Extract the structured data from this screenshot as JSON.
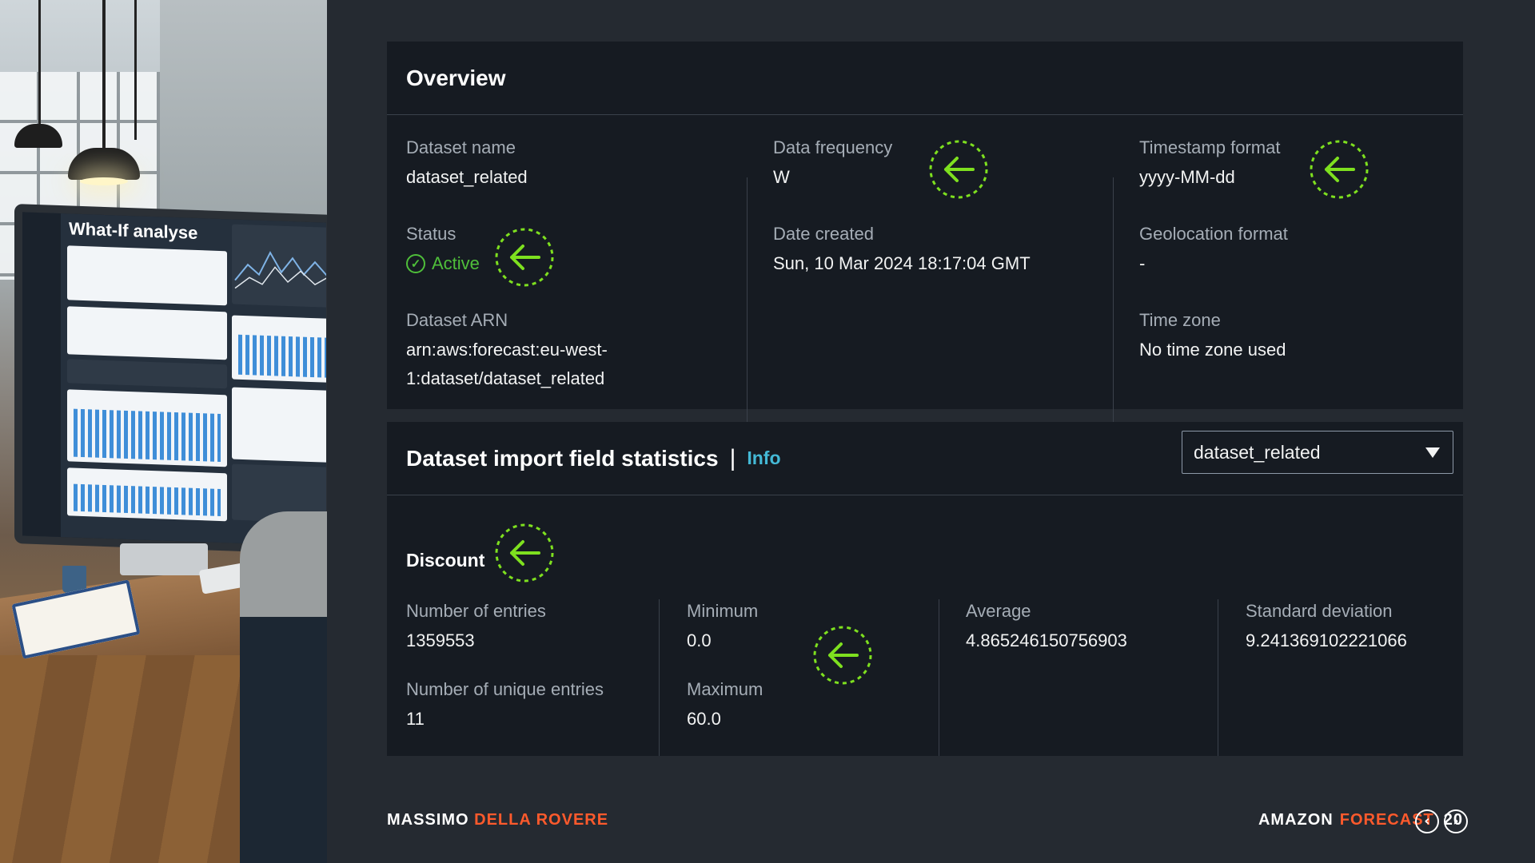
{
  "illustration": {
    "monitor_title": "What-If analyse"
  },
  "overview": {
    "title": "Overview",
    "dataset_name": {
      "label": "Dataset name",
      "value": "dataset_related"
    },
    "status": {
      "label": "Status",
      "value": "Active"
    },
    "dataset_arn": {
      "label": "Dataset ARN",
      "value_line1": "arn:aws:forecast:eu-west-",
      "value_line2": "1:dataset/dataset_related"
    },
    "data_frequency": {
      "label": "Data frequency",
      "value": "W"
    },
    "date_created": {
      "label": "Date created",
      "value": "Sun, 10 Mar 2024 18:17:04 GMT"
    },
    "timestamp_format": {
      "label": "Timestamp format",
      "value": "yyyy-MM-dd"
    },
    "geolocation_format": {
      "label": "Geolocation format",
      "value": "-"
    },
    "time_zone": {
      "label": "Time zone",
      "value": "No time zone used"
    }
  },
  "stats": {
    "title": "Dataset import field statistics",
    "separator": "|",
    "info_label": "Info",
    "select_value": "dataset_related",
    "field_name": "Discount",
    "number_of_entries": {
      "label": "Number of entries",
      "value": "1359553"
    },
    "number_of_unique_entries": {
      "label": "Number of unique entries",
      "value": "11"
    },
    "minimum": {
      "label": "Minimum",
      "value": "0.0"
    },
    "maximum": {
      "label": "Maximum",
      "value": "60.0"
    },
    "average": {
      "label": "Average",
      "value": "4.865246150756903"
    },
    "standard_deviation": {
      "label": "Standard deviation",
      "value": "9.241369102221066"
    }
  },
  "footer": {
    "author_first": "MASSIMO",
    "author_last": "DELLA ROVERE",
    "product_first": "AMAZON",
    "product_last": "FORECAST",
    "page_number": "20"
  },
  "colors": {
    "marker": "#7ee01f",
    "accent": "#ff5a2c",
    "info_link": "#44b9d6",
    "status_active": "#4fbf3a"
  },
  "icons": [
    "check-circle-icon",
    "arrow-left-icon",
    "caret-down-icon",
    "chevron-left-icon",
    "chevron-right-icon"
  ]
}
